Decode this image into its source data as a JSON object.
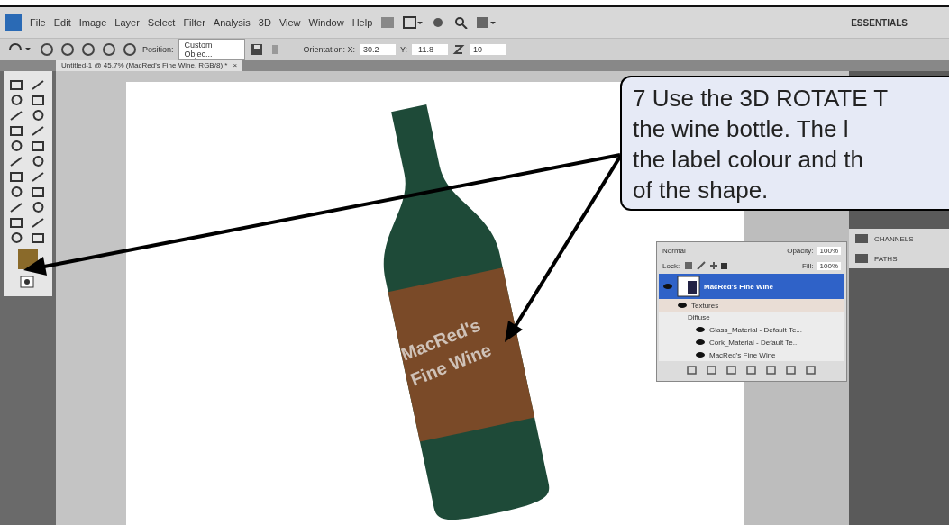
{
  "menu_bar": {
    "items": [
      "File",
      "Edit",
      "Image",
      "Layer",
      "Select",
      "Filter",
      "Analysis",
      "3D",
      "View",
      "Window",
      "Help"
    ],
    "workspace": "ESSENTIALS"
  },
  "options_bar": {
    "position_label": "Position:",
    "position_value": "Custom Objec...",
    "orientation_label": "Orientation: X:",
    "x_value": "30.2",
    "y_label": "Y:",
    "y_value": "-11.8",
    "z_value": "10"
  },
  "document_tab": {
    "title": "Untitled-1 @ 45.7% (MacRed's Fine Wine, RGB/8) *",
    "close": "×"
  },
  "canvas": {
    "bottle_label": [
      "MacRed's",
      "Fine Wine"
    ]
  },
  "layers_panel": {
    "blend_mode": "Normal",
    "opacity_label": "Opacity:",
    "opacity": "100%",
    "lock_label": "Lock:",
    "fill_label": "Fill:",
    "fill": "100%",
    "layers": [
      {
        "name": "MacRed's Fine Wine",
        "selected": true,
        "children": [
          {
            "name": "Textures",
            "children": [
              {
                "name": "Diffuse",
                "children": [
                  {
                    "name": "Glass_Material - Default Te..."
                  },
                  {
                    "name": "Cork_Material - Default Te..."
                  },
                  {
                    "name": "MacRed's Fine Wine"
                  }
                ]
              }
            ]
          }
        ]
      }
    ]
  },
  "side_dock": {
    "items": [
      "CHANNELS",
      "PATHS"
    ]
  },
  "callout": {
    "lines": [
      "7 Use the 3D ROTATE T",
      "the wine bottle.  The l",
      "the label colour and th",
      "of the shape."
    ]
  }
}
